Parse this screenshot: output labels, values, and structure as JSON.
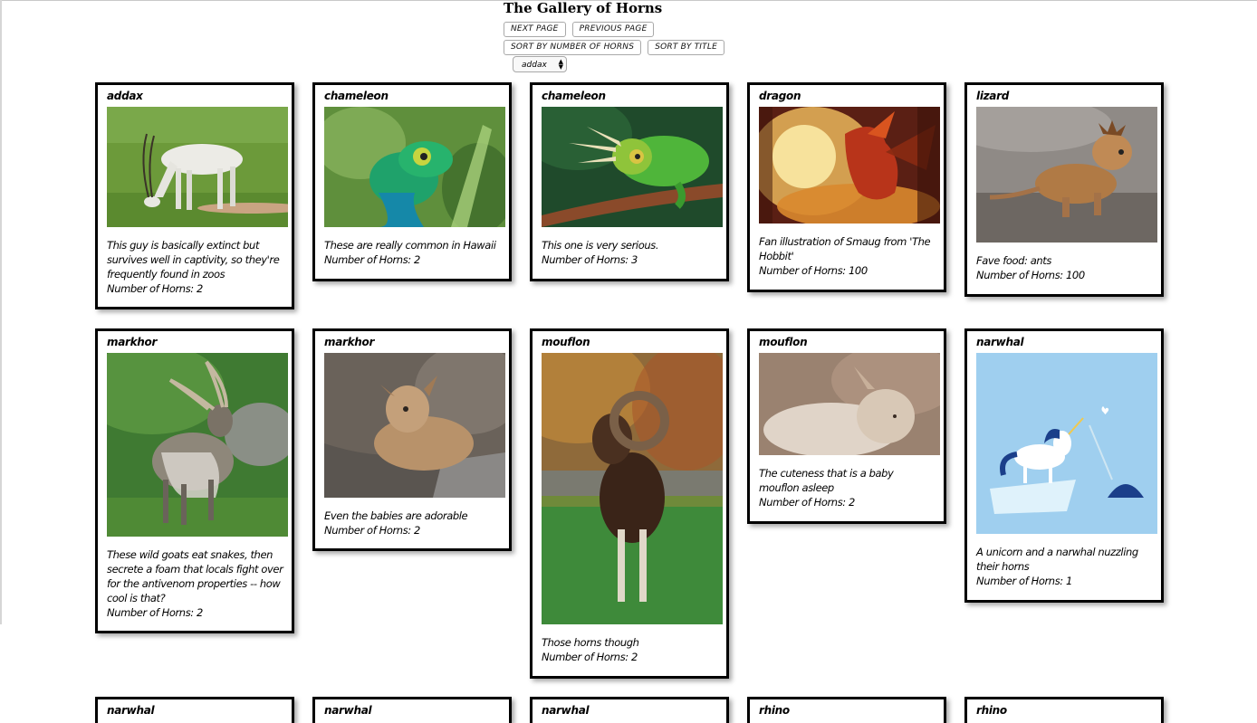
{
  "page": {
    "title": "The Gallery of Horns",
    "buttons": {
      "next": "NEXT PAGE",
      "previous": "PREVIOUS PAGE",
      "sort_horns": "SORT BY NUMBER OF HORNS",
      "sort_title": "SORT BY TITLE"
    },
    "filter": {
      "selected": "addax"
    },
    "horns_prefix": "Number of Horns:"
  },
  "cards": [
    {
      "title": "addax",
      "image": "addax-photo",
      "description": "This guy is basically extinct but survives well in captivity, so they're frequently found in zoos",
      "horns": "Number of Horns: 2"
    },
    {
      "title": "chameleon",
      "image": "chameleon-photo",
      "description": "These are really common in Hawaii",
      "horns": "Number of Horns: 2"
    },
    {
      "title": "chameleon",
      "image": "chameleon-photo",
      "description": "This one is very serious.",
      "horns": "Number of Horns: 3"
    },
    {
      "title": "dragon",
      "image": "dragon-illustration",
      "description": "Fan illustration of Smaug from 'The Hobbit'",
      "horns": "Number of Horns: 100"
    },
    {
      "title": "lizard",
      "image": "horned-lizard-photo",
      "description": "Fave food: ants",
      "horns": "Number of Horns: 100"
    },
    {
      "title": "markhor",
      "image": "markhor-photo",
      "description": "These wild goats eat snakes, then secrete a foam that locals fight over for the antivenom properties -- how cool is that?",
      "horns": "Number of Horns: 2"
    },
    {
      "title": "markhor",
      "image": "baby-markhor-photo",
      "description": "Even the babies are adorable",
      "horns": "Number of Horns: 2"
    },
    {
      "title": "mouflon",
      "image": "mouflon-photo",
      "description": "Those horns though",
      "horns": "Number of Horns: 2"
    },
    {
      "title": "mouflon",
      "image": "baby-mouflon-photo",
      "description": "The cuteness that is a baby mouflon asleep",
      "horns": "Number of Horns: 2"
    },
    {
      "title": "narwhal",
      "image": "unicorn-narwhal-illustration",
      "description": "A unicorn and a narwhal nuzzling their horns",
      "horns": "Number of Horns: 1"
    },
    {
      "title": "narwhal"
    },
    {
      "title": "narwhal"
    },
    {
      "title": "narwhal"
    },
    {
      "title": "rhino"
    },
    {
      "title": "rhino"
    }
  ]
}
